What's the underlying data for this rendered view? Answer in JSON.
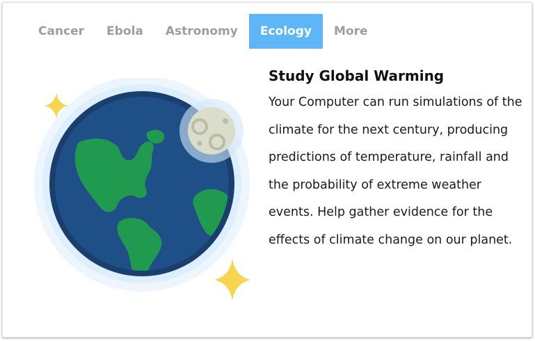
{
  "tabs": [
    {
      "label": "Cancer",
      "active": false
    },
    {
      "label": "Ebola",
      "active": false
    },
    {
      "label": "Astronomy",
      "active": false
    },
    {
      "label": "Ecology",
      "active": true
    },
    {
      "label": "More",
      "active": false
    }
  ],
  "content": {
    "title": "Study Global Warming",
    "description": "Your Computer can run simulations of the climate for the next century, producing predictions of temperature, rainfall and the probability of extreme weather events. Help gather evidence for the effects of climate change on our planet."
  },
  "illustration": {
    "icons": [
      "earth-icon",
      "moon-icon",
      "sparkle-icon"
    ]
  },
  "colors": {
    "active_tab": "#5eb6f6",
    "inactive_tab_text": "#9e9e9e",
    "ocean": "#1f4f87",
    "land": "#1f9a4e",
    "star": "#f9d44e",
    "moon": "#d9ddca"
  }
}
